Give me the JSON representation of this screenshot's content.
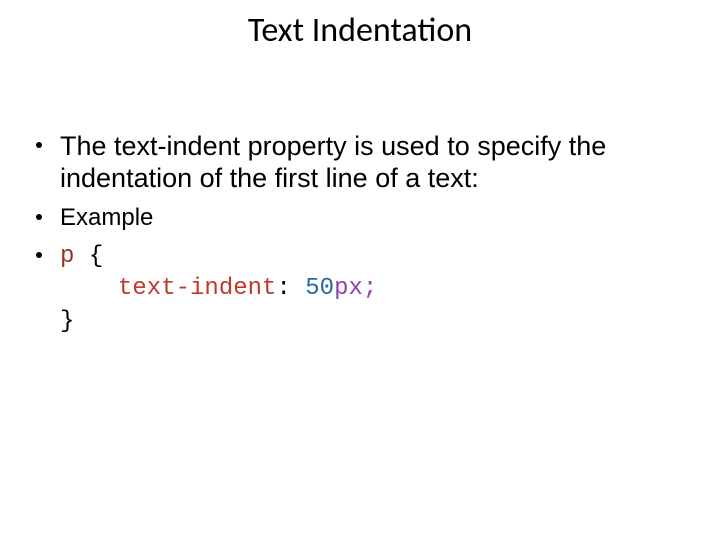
{
  "title": "Text Indentation",
  "bullets": {
    "intro": "The text-indent property is used to specify the indentation of the first line of a text:",
    "example_label": "Example"
  },
  "code": {
    "selector": "p",
    "brace_open": "{",
    "property": "text-indent",
    "colon": ":",
    "number": "50",
    "unit_semi": "px;",
    "brace_close": "}"
  }
}
